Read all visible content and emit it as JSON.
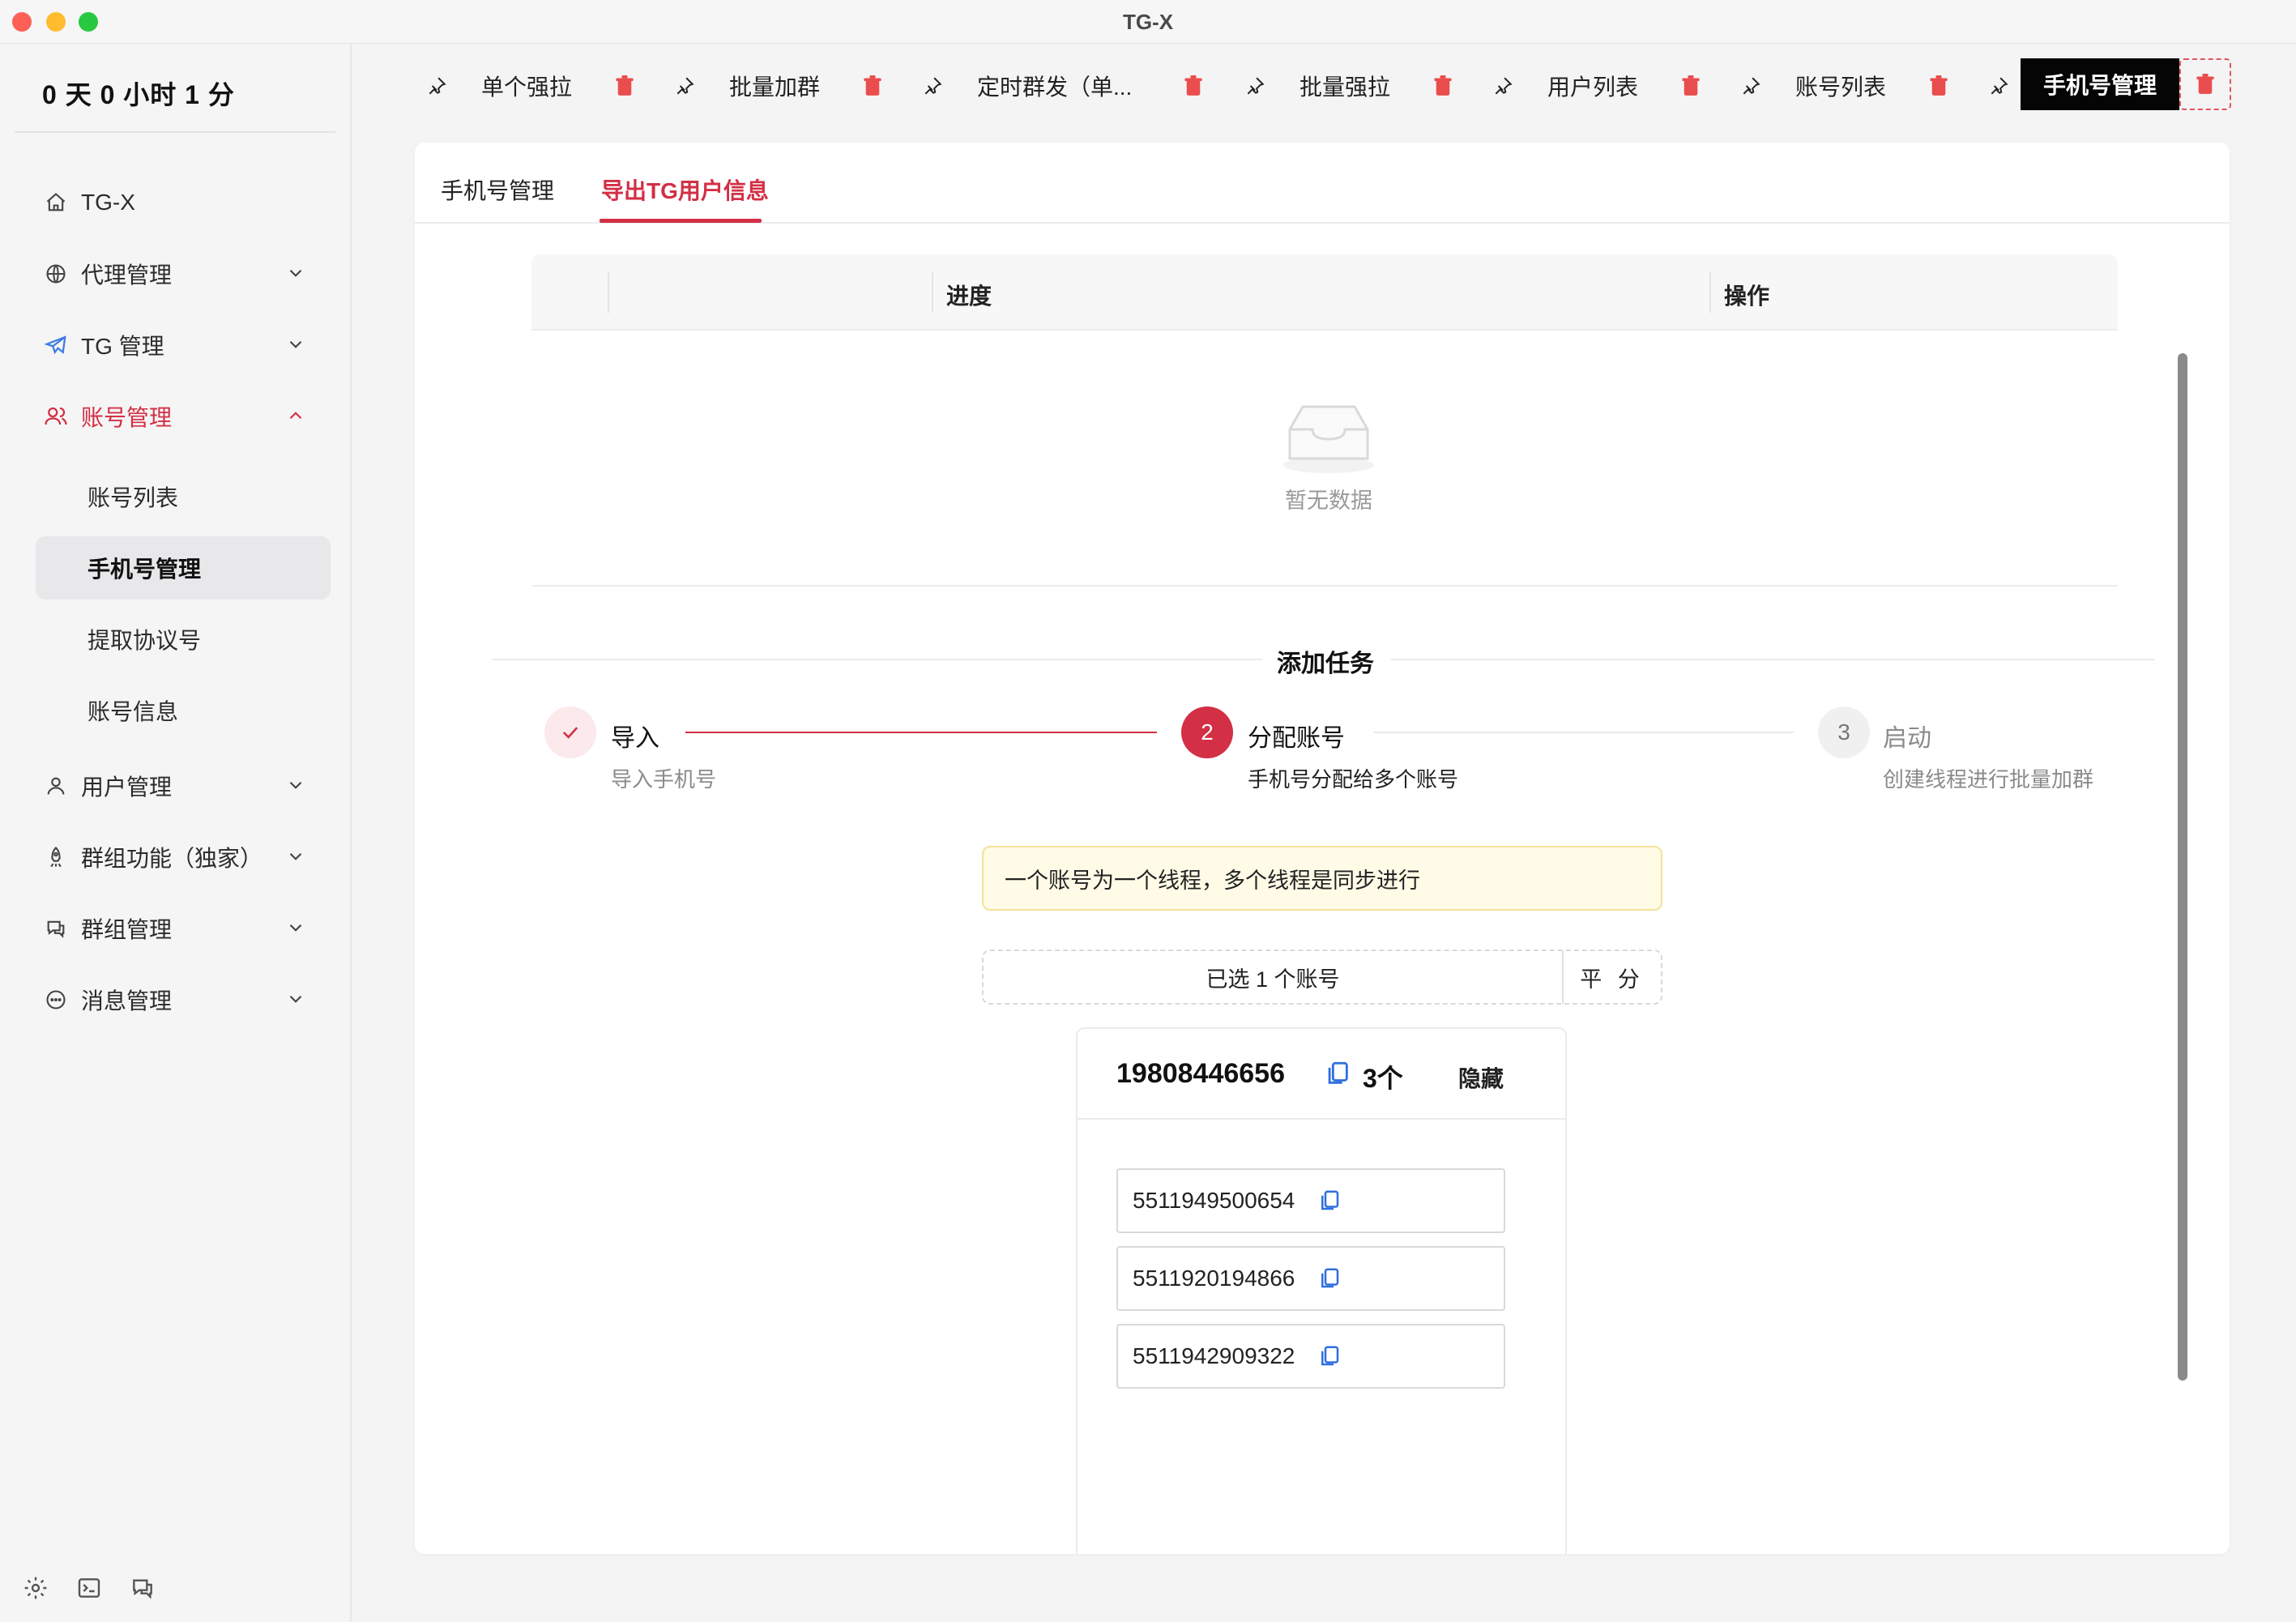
{
  "window": {
    "title": "TG-X"
  },
  "sidebar": {
    "uptime": "0 天 0 小时 1 分",
    "items": [
      {
        "label": "TG-X",
        "icon": "home-icon"
      },
      {
        "label": "代理管理",
        "icon": "globe-icon"
      },
      {
        "label": "TG 管理",
        "icon": "telegram-icon"
      },
      {
        "label": "账号管理",
        "icon": "users-icon"
      },
      {
        "label": "用户管理",
        "icon": "user-icon"
      },
      {
        "label": "群组功能（独家）",
        "icon": "rocket-icon"
      },
      {
        "label": "群组管理",
        "icon": "chat-group-icon"
      },
      {
        "label": "消息管理",
        "icon": "message-icon"
      }
    ],
    "sub_items": [
      "账号列表",
      "手机号管理",
      "提取协议号",
      "账号信息"
    ]
  },
  "tabs": [
    {
      "label": "单个强拉"
    },
    {
      "label": "批量加群"
    },
    {
      "label": "定时群发（单..."
    },
    {
      "label": "批量强拉"
    },
    {
      "label": "用户列表"
    },
    {
      "label": "账号列表"
    },
    {
      "label": "手机号管理",
      "active": true
    }
  ],
  "subtabs": [
    "手机号管理",
    "导出TG用户信息"
  ],
  "table": {
    "columns": [
      "进度",
      "操作"
    ],
    "empty_text": "暂无数据"
  },
  "section_title": "添加任务",
  "steps": [
    {
      "number": "1",
      "title": "导入",
      "desc": "导入手机号",
      "status": "done"
    },
    {
      "number": "2",
      "title": "分配账号",
      "desc": "手机号分配给多个账号",
      "status": "current"
    },
    {
      "number": "3",
      "title": "启动",
      "desc": "创建线程进行批量加群",
      "status": "wait"
    }
  ],
  "alert": "一个账号为一个线程，多个线程是同步进行",
  "selector": {
    "text": "已选  1  个账号",
    "button": "平 分"
  },
  "account": {
    "phone": "19808446656",
    "count": "3个",
    "hide_label": "隐藏",
    "numbers": [
      "5511949500654",
      "5511920194866",
      "5511942909322"
    ]
  },
  "colors": {
    "accent": "#d32f45",
    "active_tab_bg": "#050505",
    "alert_bg": "#fffbe6",
    "copy_icon": "#2f6fdf"
  }
}
